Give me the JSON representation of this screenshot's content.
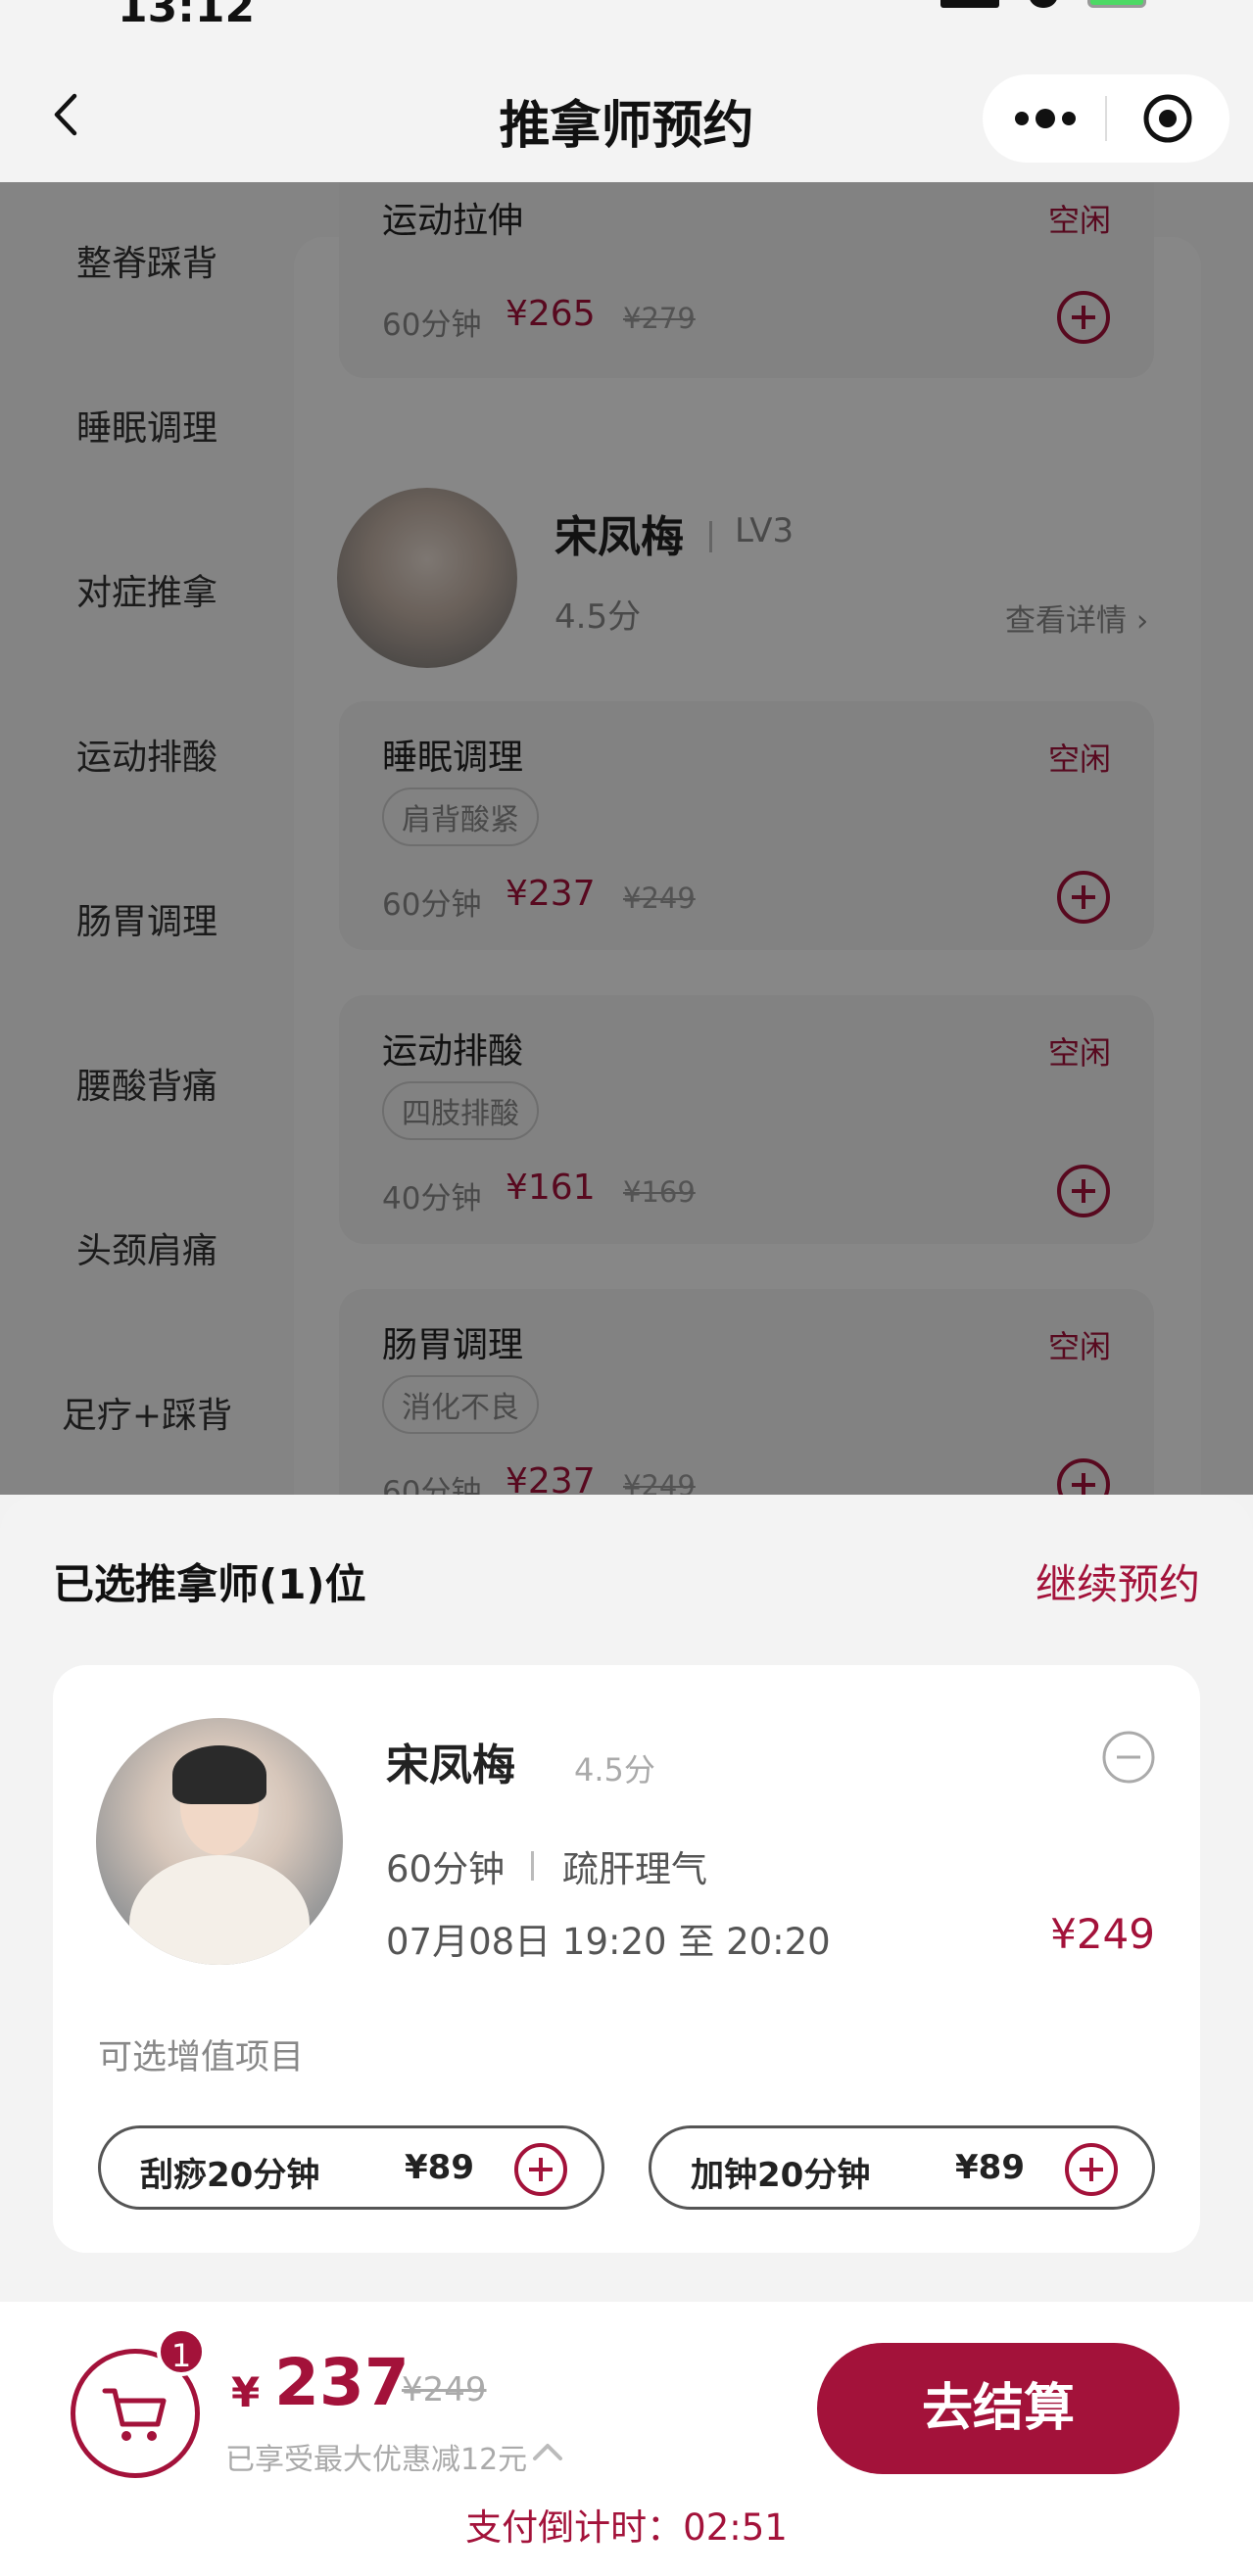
{
  "status": {
    "time": "13:12"
  },
  "nav": {
    "title": "推拿师预约"
  },
  "sidebar": {
    "items": [
      {
        "label": "整脊踩背"
      },
      {
        "label": "睡眠调理"
      },
      {
        "label": "对症推拿"
      },
      {
        "label": "运动排酸"
      },
      {
        "label": "肠胃调理"
      },
      {
        "label": "腰酸背痛"
      },
      {
        "label": "头颈肩痛"
      },
      {
        "label": "足疗+踩背"
      }
    ]
  },
  "list": {
    "first_card": {
      "name": "运动拉伸",
      "status": "空闲",
      "duration": "60分钟",
      "price": "¥265",
      "orig": "¥279"
    },
    "therapist": {
      "name": "宋凤梅",
      "level": "LV3",
      "score": "4.5分",
      "detail": "查看详情"
    },
    "services": [
      {
        "name": "睡眠调理",
        "status": "空闲",
        "tag": "肩背酸紧",
        "duration": "60分钟",
        "price": "¥237",
        "orig": "¥249"
      },
      {
        "name": "运动排酸",
        "status": "空闲",
        "tag": "四肢排酸",
        "duration": "40分钟",
        "price": "¥161",
        "orig": "¥169"
      },
      {
        "name": "肠胃调理",
        "status": "空闲",
        "tag": "消化不良",
        "duration": "60分钟",
        "price": "¥237",
        "orig": "¥249"
      }
    ]
  },
  "sheet": {
    "title": "已选推拿师(1)位",
    "continue": "继续预约",
    "selected": {
      "name": "宋凤梅",
      "score": "4.5分",
      "duration": "60分钟",
      "service": "疏肝理气",
      "time": "07月08日 19:20 至 20:20",
      "price": "¥249"
    },
    "addon_title": "可选增值项目",
    "addons": [
      {
        "label": "刮痧20分钟",
        "price": "¥89"
      },
      {
        "label": "加钟20分钟",
        "price": "¥89"
      }
    ]
  },
  "footer": {
    "cart_count": "1",
    "currency": "¥",
    "total": "237",
    "orig": "¥249",
    "discount_note": "已享受最大优惠减12元",
    "checkout": "去结算",
    "countdown": "支付倒计时：02:51"
  },
  "colors": {
    "accent": "#a3123a"
  },
  "icons": [
    "back-icon",
    "more-icon",
    "record-icon",
    "plus-icon",
    "minus-icon",
    "cart-icon",
    "chevron-up-icon"
  ]
}
